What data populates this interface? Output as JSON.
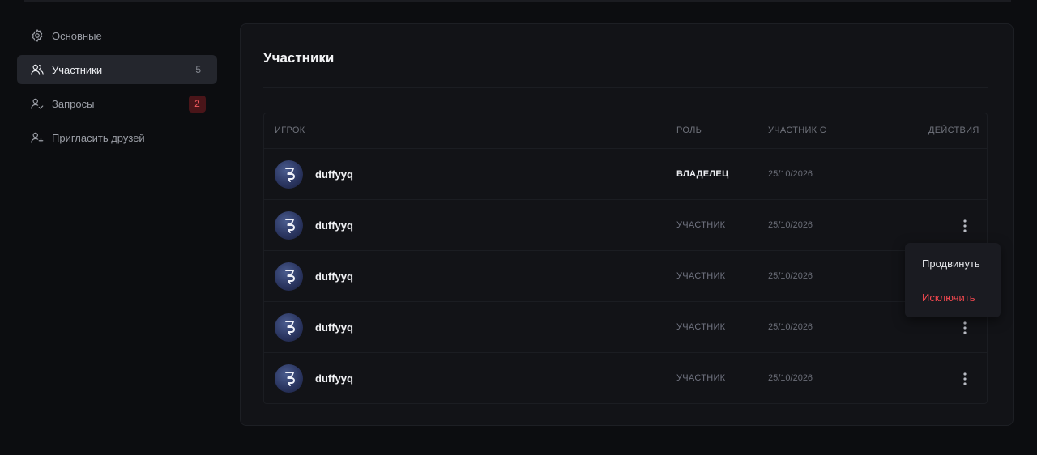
{
  "sidebar": {
    "items": [
      {
        "label": "Основные",
        "icon": "gear-icon",
        "active": false
      },
      {
        "label": "Участники",
        "icon": "users-icon",
        "active": true,
        "count": "5"
      },
      {
        "label": "Запросы",
        "icon": "user-check-icon",
        "active": false,
        "badge": "2"
      },
      {
        "label": "Пригласить друзей",
        "icon": "user-plus-icon",
        "active": false
      }
    ]
  },
  "main": {
    "title": "Участники",
    "columns": {
      "player": "ИГРОК",
      "role": "РОЛЬ",
      "since": "УЧАСТНИК С",
      "actions": "ДЕЙСТВИЯ"
    },
    "rows": [
      {
        "name": "duffyyq",
        "role": "ВЛАДЕЛЕЦ",
        "date": "25/10/2026"
      },
      {
        "name": "duffyyq",
        "role": "УЧАСТНИК",
        "date": "25/10/2026"
      },
      {
        "name": "duffyyq",
        "role": "УЧАСТНИК",
        "date": "25/10/2026"
      },
      {
        "name": "duffyyq",
        "role": "УЧАСТНИК",
        "date": "25/10/2026"
      },
      {
        "name": "duffyyq",
        "role": "УЧАСТНИК",
        "date": "25/10/2026"
      }
    ]
  },
  "menu": {
    "promote": "Продвинуть",
    "kick": "Исключить"
  },
  "colors": {
    "background": "#0c0d10",
    "panel": "#121317",
    "active_item": "#24262d",
    "danger": "#f2484f"
  }
}
